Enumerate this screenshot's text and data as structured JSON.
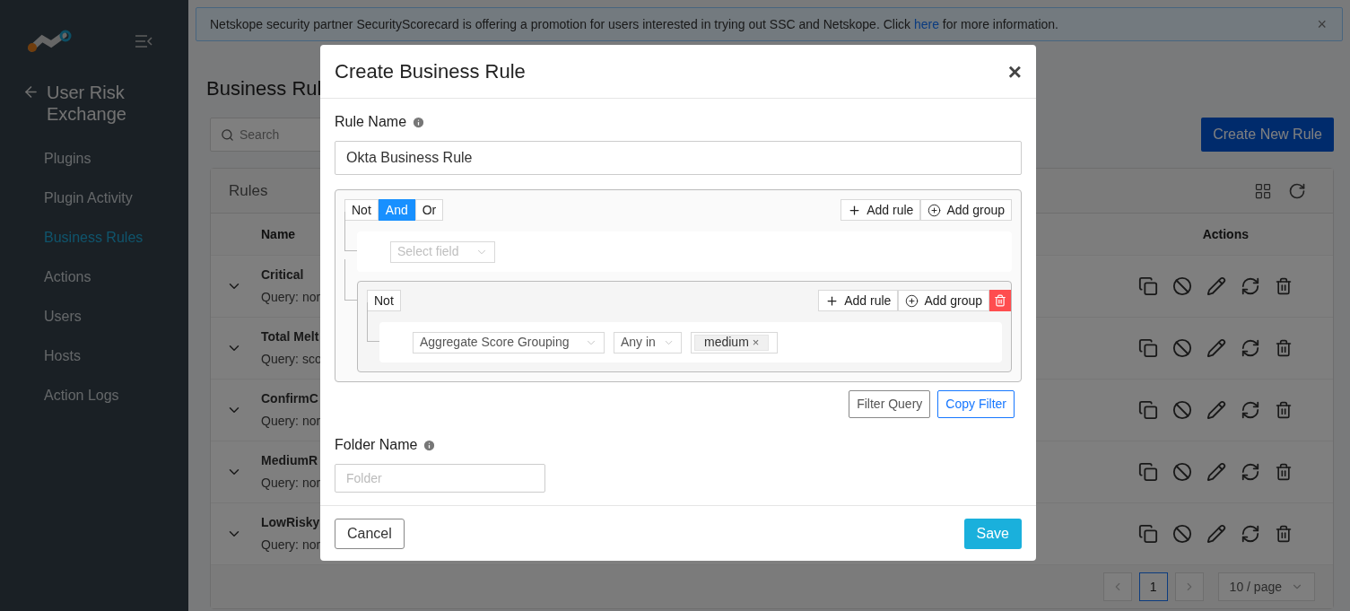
{
  "banner": {
    "text": "Netskope security partner SecurityScorecard is offering a promotion for users interested in trying out SSC and Netskope. Click",
    "link": "here",
    "text_after": "for more information.",
    "close": "×"
  },
  "sidebar": {
    "title": "User Risk Exchange",
    "items": [
      {
        "label": "Plugins",
        "selected": false
      },
      {
        "label": "Plugin Activity",
        "selected": false
      },
      {
        "label": "Business Rules",
        "selected": true
      },
      {
        "label": "Actions",
        "selected": false
      },
      {
        "label": "Users",
        "selected": false
      },
      {
        "label": "Hosts",
        "selected": false
      },
      {
        "label": "Action Logs",
        "selected": false
      }
    ]
  },
  "page": {
    "title": "Business Rul",
    "search": {
      "placeholder": "Search"
    },
    "create_button": "Create New Rule",
    "table": {
      "title": "Rules",
      "columns": [
        "Name",
        "Actions"
      ],
      "rows": [
        {
          "name": "Critical",
          "query": "Query: nor"
        },
        {
          "name": "Total Melt",
          "query": "Query: sco"
        },
        {
          "name": "ConfirmC",
          "query": "Query: nor"
        },
        {
          "name": "MediumR",
          "query": "Query: nor"
        },
        {
          "name": "LowRisky",
          "query": "Query: nor"
        }
      ]
    },
    "pagination": {
      "pages": [
        {
          "label": "1",
          "selected": true
        }
      ],
      "page_size": "10 / page"
    }
  },
  "modal": {
    "title": "Create Business Rule",
    "close": "×",
    "rule_name": {
      "label": "Rule Name",
      "value": "Okta Business Rule"
    },
    "query": {
      "combinators": [
        {
          "label": "Not",
          "selected": false
        },
        {
          "label": "And",
          "selected": true
        },
        {
          "label": "Or",
          "selected": false
        }
      ],
      "add_rule": "Add rule",
      "add_group": "Add group",
      "deletable": false,
      "children": [
        {
          "kind": "rule",
          "field": {
            "placeholder": "Select field"
          }
        },
        {
          "kind": "group",
          "combinators": [
            {
              "label": "Not",
              "selected": false
            }
          ],
          "add_rule": "Add rule",
          "add_group": "Add group",
          "deletable": true,
          "children": [
            {
              "kind": "rule",
              "field": {
                "value": "Aggregate Score Grouping"
              },
              "operator": "Any in",
              "values": [
                {
                  "label": "medium",
                  "remove": "×"
                }
              ]
            }
          ]
        }
      ]
    },
    "filter_query": "Filter Query",
    "copy_filter": "Copy Filter",
    "folder": {
      "label": "Folder Name",
      "placeholder": "Folder"
    },
    "cancel": "Cancel",
    "save": "Save"
  }
}
